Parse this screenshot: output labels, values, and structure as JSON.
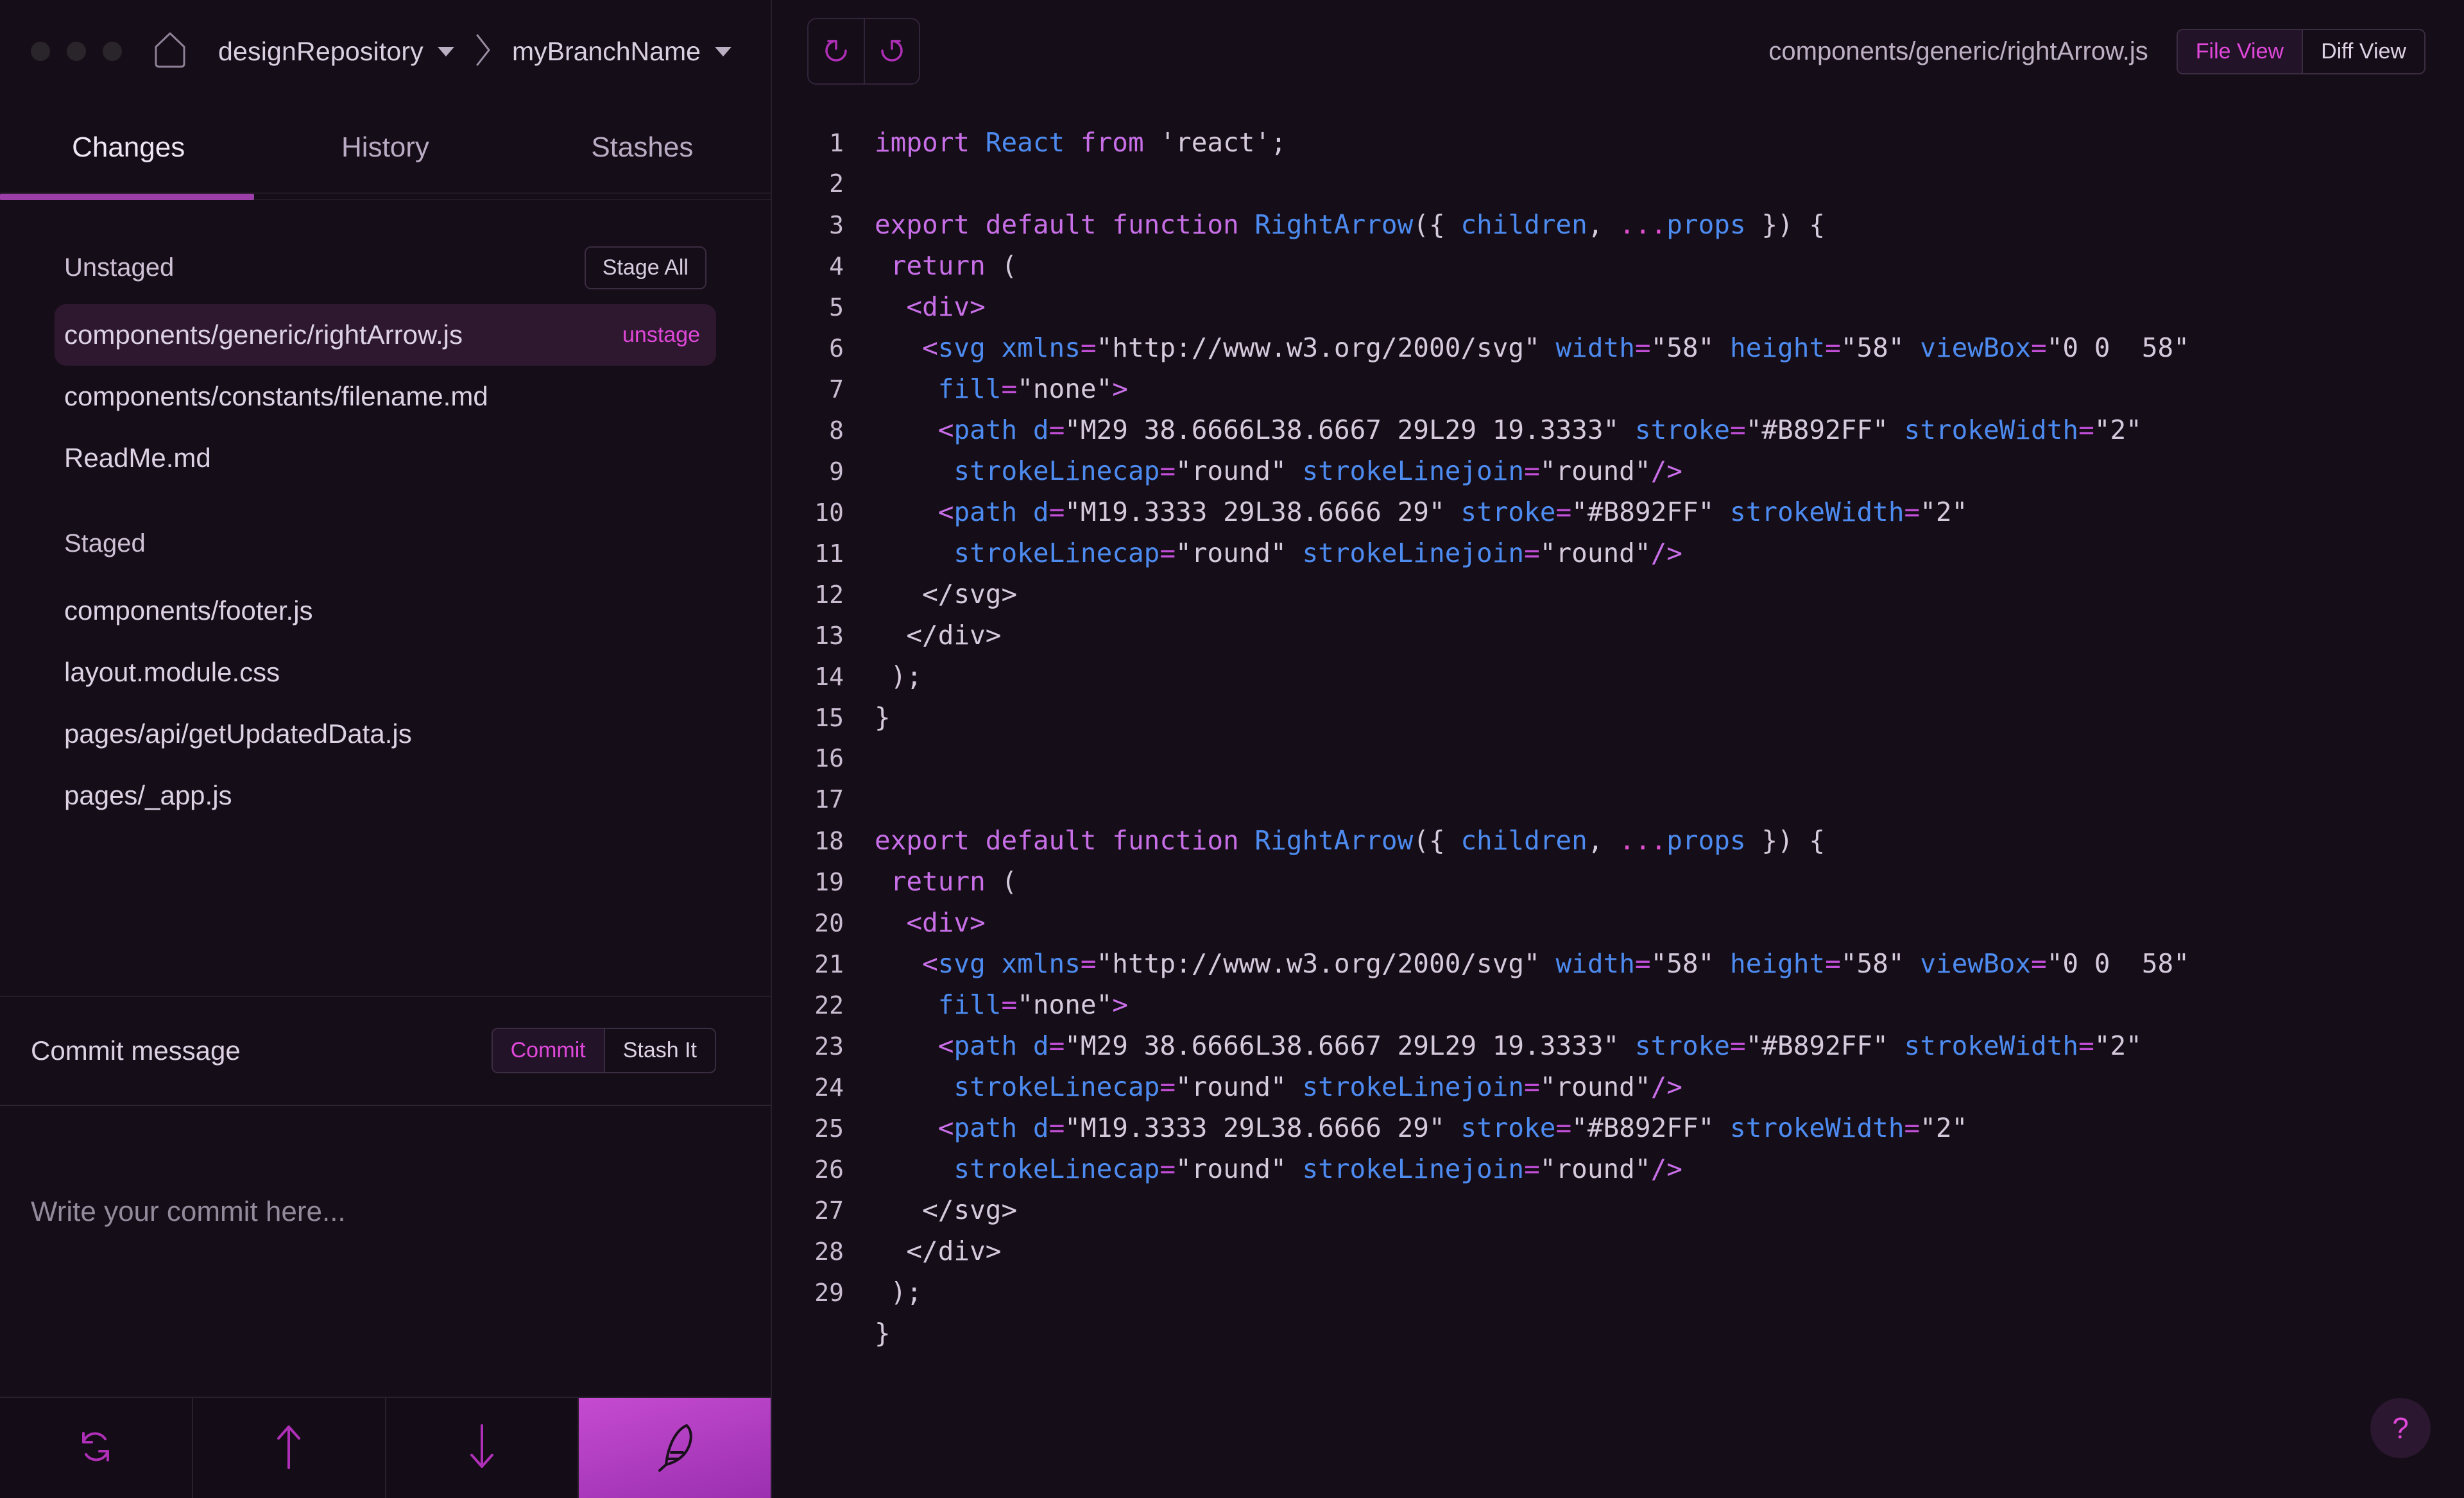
{
  "window": {
    "dots": 3,
    "home_icon": "home-icon",
    "repository": "designRepository",
    "branch": "myBranchName",
    "separator": "chevron-right-icon"
  },
  "tabs": [
    {
      "label": "Changes",
      "active": true
    },
    {
      "label": "History",
      "active": false
    },
    {
      "label": "Stashes",
      "active": false
    }
  ],
  "sidebar": {
    "unstaged": {
      "title": "Unstaged",
      "stage_all_label": "Stage All",
      "files": [
        {
          "name": "components/generic/rightArrow.js",
          "action": "unstage",
          "selected": true
        },
        {
          "name": "components/constants/filename.md",
          "action": "",
          "selected": false
        },
        {
          "name": "ReadMe.md",
          "action": "",
          "selected": false
        }
      ]
    },
    "staged": {
      "title": "Staged",
      "files": [
        {
          "name": "components/footer.js",
          "action": "",
          "selected": false
        },
        {
          "name": "layout.module.css",
          "action": "",
          "selected": false
        },
        {
          "name": "pages/api/getUpdatedData.js",
          "action": "",
          "selected": false
        },
        {
          "name": "pages/_app.js",
          "action": "",
          "selected": false
        }
      ]
    },
    "commit": {
      "label": "Commit message",
      "commit_button": "Commit",
      "stash_button": "Stash It",
      "placeholder": "Write your commit here..."
    },
    "bottom_actions": [
      {
        "icon": "sync-refresh-icon",
        "accent": false
      },
      {
        "icon": "arrow-up-push-icon",
        "accent": false
      },
      {
        "icon": "arrow-down-pull-icon",
        "accent": false
      },
      {
        "icon": "feather-quill-icon",
        "accent": true
      }
    ]
  },
  "editor": {
    "undo_icon": "undo-icon",
    "redo_icon": "redo-icon",
    "current_file": "components/generic/rightArrow.js",
    "view_modes": [
      {
        "label": "File View",
        "active": true
      },
      {
        "label": "Diff View",
        "active": false
      }
    ],
    "help_label": "?",
    "code_lines": [
      {
        "n": "1",
        "tokens": [
          [
            "kw",
            "import "
          ],
          [
            "id",
            "React"
          ],
          [
            "kw",
            " from "
          ],
          [
            "str",
            "'react'"
          ],
          [
            "punc",
            ";"
          ]
        ]
      },
      {
        "n": "2",
        "tokens": []
      },
      {
        "n": "3",
        "tokens": [
          [
            "kw",
            "export default function "
          ],
          [
            "id",
            "RightArrow"
          ],
          [
            "punc",
            "("
          ],
          [
            "punc",
            "{ "
          ],
          [
            "id",
            "children"
          ],
          [
            "punc",
            ", "
          ],
          [
            "dots",
            "..."
          ],
          [
            "id",
            "props"
          ],
          [
            "punc",
            " }) {"
          ]
        ]
      },
      {
        "n": "4",
        "tokens": [
          [
            "plain",
            " "
          ],
          [
            "kw",
            "return"
          ],
          [
            "punc",
            " ("
          ]
        ]
      },
      {
        "n": "5",
        "tokens": [
          [
            "plain",
            "  "
          ],
          [
            "tag",
            "<"
          ],
          [
            "tag",
            "div"
          ],
          [
            "tag",
            ">"
          ]
        ]
      },
      {
        "n": "6",
        "tokens": [
          [
            "plain",
            "   "
          ],
          [
            "tag",
            "<"
          ],
          [
            "tagname",
            "svg"
          ],
          [
            "plain",
            " "
          ],
          [
            "attr",
            "xmlns"
          ],
          [
            "eq",
            "="
          ],
          [
            "str",
            "\"http://www.w3.org/2000/svg\""
          ],
          [
            "plain",
            " "
          ],
          [
            "attr",
            "width"
          ],
          [
            "eq",
            "="
          ],
          [
            "str",
            "\"58\""
          ],
          [
            "plain",
            " "
          ],
          [
            "attr",
            "height"
          ],
          [
            "eq",
            "="
          ],
          [
            "str",
            "\"58\""
          ],
          [
            "plain",
            " "
          ],
          [
            "attr",
            "viewBox"
          ],
          [
            "eq",
            "="
          ],
          [
            "str",
            "\"0 0  58\""
          ]
        ]
      },
      {
        "n": "7",
        "tokens": [
          [
            "plain",
            "    "
          ],
          [
            "attr",
            "fill"
          ],
          [
            "eq",
            "="
          ],
          [
            "str",
            "\"none\""
          ],
          [
            "tag",
            ">"
          ]
        ]
      },
      {
        "n": "8",
        "tokens": [
          [
            "plain",
            "    "
          ],
          [
            "tag",
            "<"
          ],
          [
            "tagname",
            "path"
          ],
          [
            "plain",
            " "
          ],
          [
            "attr",
            "d"
          ],
          [
            "eq",
            "="
          ],
          [
            "str",
            "\"M29 38.6666L38.6667 29L29 19.3333\""
          ],
          [
            "plain",
            " "
          ],
          [
            "attr",
            "stroke"
          ],
          [
            "eq",
            "="
          ],
          [
            "str",
            "\"#B892FF\""
          ],
          [
            "plain",
            " "
          ],
          [
            "attr",
            "strokeWidth"
          ],
          [
            "eq",
            "="
          ],
          [
            "str",
            "\"2\""
          ]
        ]
      },
      {
        "n": "9",
        "tokens": [
          [
            "plain",
            "     "
          ],
          [
            "attr",
            "strokeLinecap"
          ],
          [
            "eq",
            "="
          ],
          [
            "str",
            "\"round\""
          ],
          [
            "plain",
            " "
          ],
          [
            "attr",
            "strokeLinejoin"
          ],
          [
            "eq",
            "="
          ],
          [
            "str",
            "\"round\""
          ],
          [
            "tag",
            "/>"
          ]
        ]
      },
      {
        "n": "10",
        "tokens": [
          [
            "plain",
            "    "
          ],
          [
            "tag",
            "<"
          ],
          [
            "tagname",
            "path"
          ],
          [
            "plain",
            " "
          ],
          [
            "attr",
            "d"
          ],
          [
            "eq",
            "="
          ],
          [
            "str",
            "\"M19.3333 29L38.6666 29\""
          ],
          [
            "plain",
            " "
          ],
          [
            "attr",
            "stroke"
          ],
          [
            "eq",
            "="
          ],
          [
            "str",
            "\"#B892FF\""
          ],
          [
            "plain",
            " "
          ],
          [
            "attr",
            "strokeWidth"
          ],
          [
            "eq",
            "="
          ],
          [
            "str",
            "\"2\""
          ]
        ]
      },
      {
        "n": "11",
        "tokens": [
          [
            "plain",
            "     "
          ],
          [
            "attr",
            "strokeLinecap"
          ],
          [
            "eq",
            "="
          ],
          [
            "str",
            "\"round\""
          ],
          [
            "plain",
            " "
          ],
          [
            "attr",
            "strokeLinejoin"
          ],
          [
            "eq",
            "="
          ],
          [
            "str",
            "\"round\""
          ],
          [
            "tag",
            "/>"
          ]
        ]
      },
      {
        "n": "12",
        "tokens": [
          [
            "plain",
            "   "
          ],
          [
            "plain",
            "</svg>"
          ]
        ]
      },
      {
        "n": "13",
        "tokens": [
          [
            "plain",
            "  "
          ],
          [
            "plain",
            "</div>"
          ]
        ]
      },
      {
        "n": "14",
        "tokens": [
          [
            "plain",
            " "
          ],
          [
            "punc",
            ");"
          ]
        ]
      },
      {
        "n": "15",
        "tokens": [
          [
            "punc",
            "}"
          ]
        ]
      },
      {
        "n": "16",
        "tokens": []
      },
      {
        "n": "17",
        "tokens": []
      },
      {
        "n": "18",
        "tokens": [
          [
            "kw",
            "export default function "
          ],
          [
            "id",
            "RightArrow"
          ],
          [
            "punc",
            "("
          ],
          [
            "punc",
            "{ "
          ],
          [
            "id",
            "children"
          ],
          [
            "punc",
            ", "
          ],
          [
            "dots",
            "..."
          ],
          [
            "id",
            "props"
          ],
          [
            "punc",
            " }) {"
          ]
        ]
      },
      {
        "n": "19",
        "tokens": [
          [
            "plain",
            " "
          ],
          [
            "kw",
            "return"
          ],
          [
            "punc",
            " ("
          ]
        ]
      },
      {
        "n": "20",
        "tokens": [
          [
            "plain",
            "  "
          ],
          [
            "tag",
            "<"
          ],
          [
            "tag",
            "div"
          ],
          [
            "tag",
            ">"
          ]
        ]
      },
      {
        "n": "21",
        "tokens": [
          [
            "plain",
            "   "
          ],
          [
            "tag",
            "<"
          ],
          [
            "tagname",
            "svg"
          ],
          [
            "plain",
            " "
          ],
          [
            "attr",
            "xmlns"
          ],
          [
            "eq",
            "="
          ],
          [
            "str",
            "\"http://www.w3.org/2000/svg\""
          ],
          [
            "plain",
            " "
          ],
          [
            "attr",
            "width"
          ],
          [
            "eq",
            "="
          ],
          [
            "str",
            "\"58\""
          ],
          [
            "plain",
            " "
          ],
          [
            "attr",
            "height"
          ],
          [
            "eq",
            "="
          ],
          [
            "str",
            "\"58\""
          ],
          [
            "plain",
            " "
          ],
          [
            "attr",
            "viewBox"
          ],
          [
            "eq",
            "="
          ],
          [
            "str",
            "\"0 0  58\""
          ]
        ]
      },
      {
        "n": "22",
        "tokens": [
          [
            "plain",
            "    "
          ],
          [
            "attr",
            "fill"
          ],
          [
            "eq",
            "="
          ],
          [
            "str",
            "\"none\""
          ],
          [
            "tag",
            ">"
          ]
        ]
      },
      {
        "n": "23",
        "tokens": [
          [
            "plain",
            "    "
          ],
          [
            "tag",
            "<"
          ],
          [
            "tagname",
            "path"
          ],
          [
            "plain",
            " "
          ],
          [
            "attr",
            "d"
          ],
          [
            "eq",
            "="
          ],
          [
            "str",
            "\"M29 38.6666L38.6667 29L29 19.3333\""
          ],
          [
            "plain",
            " "
          ],
          [
            "attr",
            "stroke"
          ],
          [
            "eq",
            "="
          ],
          [
            "str",
            "\"#B892FF\""
          ],
          [
            "plain",
            " "
          ],
          [
            "attr",
            "strokeWidth"
          ],
          [
            "eq",
            "="
          ],
          [
            "str",
            "\"2\""
          ]
        ]
      },
      {
        "n": "24",
        "tokens": [
          [
            "plain",
            "     "
          ],
          [
            "attr",
            "strokeLinecap"
          ],
          [
            "eq",
            "="
          ],
          [
            "str",
            "\"round\""
          ],
          [
            "plain",
            " "
          ],
          [
            "attr",
            "strokeLinejoin"
          ],
          [
            "eq",
            "="
          ],
          [
            "str",
            "\"round\""
          ],
          [
            "tag",
            "/>"
          ]
        ]
      },
      {
        "n": "25",
        "tokens": [
          [
            "plain",
            "    "
          ],
          [
            "tag",
            "<"
          ],
          [
            "tagname",
            "path"
          ],
          [
            "plain",
            " "
          ],
          [
            "attr",
            "d"
          ],
          [
            "eq",
            "="
          ],
          [
            "str",
            "\"M19.3333 29L38.6666 29\""
          ],
          [
            "plain",
            " "
          ],
          [
            "attr",
            "stroke"
          ],
          [
            "eq",
            "="
          ],
          [
            "str",
            "\"#B892FF\""
          ],
          [
            "plain",
            " "
          ],
          [
            "attr",
            "strokeWidth"
          ],
          [
            "eq",
            "="
          ],
          [
            "str",
            "\"2\""
          ]
        ]
      },
      {
        "n": "26",
        "tokens": [
          [
            "plain",
            "     "
          ],
          [
            "attr",
            "strokeLinecap"
          ],
          [
            "eq",
            "="
          ],
          [
            "str",
            "\"round\""
          ],
          [
            "plain",
            " "
          ],
          [
            "attr",
            "strokeLinejoin"
          ],
          [
            "eq",
            "="
          ],
          [
            "str",
            "\"round\""
          ],
          [
            "tag",
            "/>"
          ]
        ]
      },
      {
        "n": "27",
        "tokens": [
          [
            "plain",
            "   "
          ],
          [
            "plain",
            "</svg>"
          ]
        ]
      },
      {
        "n": "28",
        "tokens": [
          [
            "plain",
            "  "
          ],
          [
            "plain",
            "</div>"
          ]
        ]
      },
      {
        "n": "29",
        "tokens": [
          [
            "plain",
            " "
          ],
          [
            "punc",
            ");"
          ]
        ]
      },
      {
        "n": "",
        "tokens": [
          [
            "punc",
            "}"
          ]
        ]
      }
    ]
  },
  "colors": {
    "background": "#150d17",
    "accent_magenta": "#e048d9",
    "accent_purple": "#9c3fa8",
    "keyword": "#c86fe8",
    "identifier": "#4d8bf0",
    "string": "#d5c9dc",
    "selected_row": "#2e1830"
  }
}
